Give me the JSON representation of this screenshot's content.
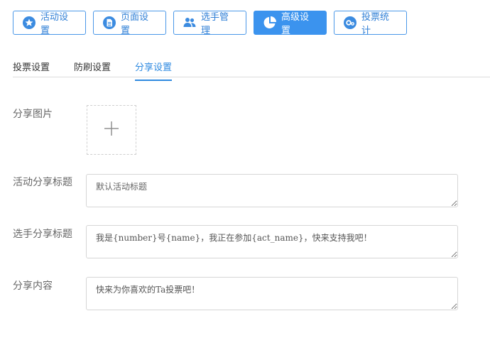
{
  "top_buttons": [
    {
      "label": "活动设置",
      "icon": "star-icon"
    },
    {
      "label": "页面设置",
      "icon": "document-icon"
    },
    {
      "label": "选手管理",
      "icon": "users-icon"
    },
    {
      "label": "高级设置",
      "icon": "pie-chart-icon",
      "active": true
    },
    {
      "label": "投票统计",
      "icon": "gears-icon"
    }
  ],
  "tabs": [
    {
      "label": "投票设置"
    },
    {
      "label": "防刷设置"
    },
    {
      "label": "分享设置",
      "active": true
    }
  ],
  "form": {
    "share_image_label": "分享图片",
    "activity_share_title_label": "活动分享标题",
    "activity_share_title_placeholder": "默认活动标题",
    "contestant_share_title_label": "选手分享标题",
    "contestant_share_title_value": "我是{number}号{name}，我正在参加{act_name}，快来支持我吧！",
    "share_content_label": "分享内容",
    "share_content_value": "快来为你喜欢的Ta投票吧！"
  },
  "colors": {
    "accent": "#3b93ee",
    "tab_active": "#2f8ae0"
  }
}
